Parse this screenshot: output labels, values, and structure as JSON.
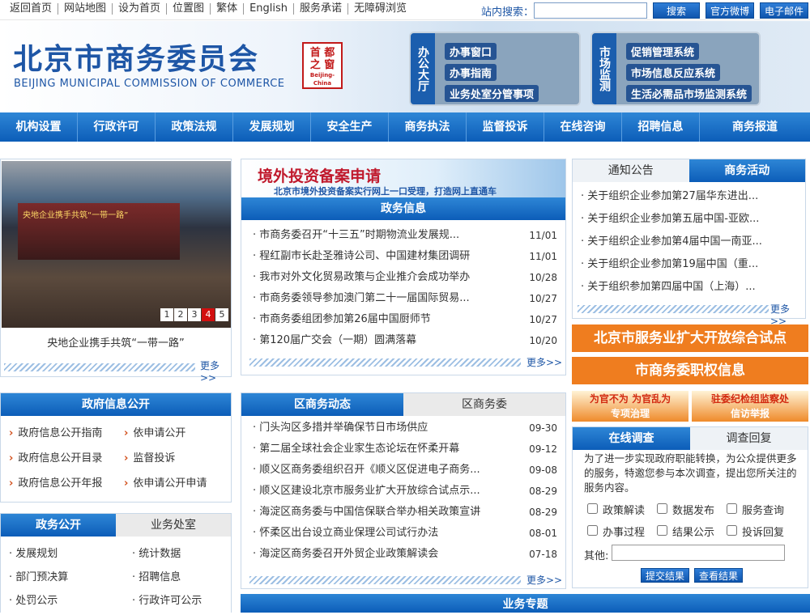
{
  "top": {
    "links": [
      "返回首页",
      "网站地图",
      "设为首页",
      "位置图",
      "繁体",
      "English",
      "服务承诺",
      "无障碍浏览"
    ],
    "search_label": "站内搜索：",
    "search_placeholder": "",
    "btn_search": "搜索",
    "btn_weibo": "官方微博",
    "btn_mail": "电子邮件"
  },
  "header": {
    "title_cn": "北京市商务委员会",
    "title_en": "BEIJING MUNICIPAL COMMISSION OF COMMERCE",
    "seal_top": "首 都",
    "seal_mid": "之 窗",
    "seal_sub": "Beijing-China",
    "panel1": {
      "tab": "办公大厅",
      "links": [
        "办事窗口",
        "办事指南",
        "业务处室分管事项"
      ]
    },
    "panel2": {
      "tab": "市场监测",
      "links": [
        "促销管理系统",
        "市场信息反应系统",
        "生活必需品市场监测系统"
      ]
    }
  },
  "nav": [
    "机构设置",
    "行政许可",
    "政策法规",
    "发展规划",
    "安全生产",
    "商务执法",
    "监督投诉",
    "在线咨询",
    "招聘信息",
    "商务报道"
  ],
  "slide": {
    "caption": "央地企业携手共筑“一带一路”",
    "pages": [
      "1",
      "2",
      "3",
      "4",
      "5"
    ],
    "active": "4",
    "more": "更多>>",
    "screen_text": "央地企业携手共筑“一带一路”"
  },
  "center_banner": {
    "title": "境外投资备案申请",
    "sub": "北京市境外投资备案实行网上一口受理，打造网上直通车"
  },
  "zwxx": {
    "title": "政务信息",
    "more": "更多>>",
    "items": [
      {
        "t": "市商务委召开“十三五”时期物流业发展规...",
        "d": "11/01"
      },
      {
        "t": "程红副市长赴圣雅诗公司、中国建材集团调研",
        "d": "11/01"
      },
      {
        "t": "我市对外文化贸易政策与企业推介会成功举办",
        "d": "10/28"
      },
      {
        "t": "市商务委领导参加澳门第二十一届国际贸易...",
        "d": "10/27"
      },
      {
        "t": "市商务委组团参加第26届中国厨师节",
        "d": "10/27"
      },
      {
        "t": "第120届广交会（一期）圆满落幕",
        "d": "10/20"
      }
    ]
  },
  "notice": {
    "tab1": "通知公告",
    "tab2": "商务活动",
    "more": "更多>>",
    "items": [
      "关于组织企业参加第27届华东进出...",
      "关于组织企业参加第五届中国-亚欧...",
      "关于组织企业参加第4届中国一南亚...",
      "关于组织企业参加第19届中国（重...",
      "关于组织参加第四届中国（上海）..."
    ]
  },
  "right_banners": {
    "b1": "北京市服务业扩大开放综合试点",
    "b2": "市商务委职权信息",
    "b3a": "为官不为 为官乱为",
    "b3b": "专项治理",
    "b4a": "驻委纪检组监察处",
    "b4b": "信访举报"
  },
  "gov": {
    "title": "政府信息公开",
    "items": [
      "政府信息公开指南",
      "依申请公开",
      "政府信息公开目录",
      "监督投诉",
      "政府信息公开年报",
      "依申请公开申请"
    ]
  },
  "district": {
    "tab1": "区商务动态",
    "tab2": "区商务委",
    "more": "更多>>",
    "items": [
      {
        "t": "门头沟区多措并举确保节日市场供应",
        "d": "09-30"
      },
      {
        "t": "第二届全球社会企业家生态论坛在怀柔开幕",
        "d": "09-12"
      },
      {
        "t": "顺义区商务委组织召开《顺义区促进电子商务...",
        "d": "09-08"
      },
      {
        "t": "顺义区建设北京市服务业扩大开放综合试点示...",
        "d": "08-29"
      },
      {
        "t": "海淀区商务委与中国信保联合举办相关政策宣讲",
        "d": "08-29"
      },
      {
        "t": "怀柔区出台设立商业保理公司试行办法",
        "d": "08-01"
      },
      {
        "t": "海淀区商务委召开外贸企业政策解读会",
        "d": "07-18"
      }
    ]
  },
  "survey": {
    "tab1": "在线调查",
    "tab2": "调查回复",
    "desc": "为了进一步实现政府职能转换，为公众提供更多的服务，特邀您参与本次调查，提出您所关注的服务内容。",
    "options": [
      "政策解读",
      "数据发布",
      "服务查询",
      "办事过程",
      "结果公示",
      "投诉回复"
    ],
    "other_label": "其他:",
    "submit": "提交结果",
    "view": "查看结果"
  },
  "zwgk": {
    "tab1": "政务公开",
    "tab2": "业务处室",
    "items": [
      "发展规划",
      "统计数据",
      "部门预决算",
      "招聘信息",
      "处罚公示",
      "行政许可公示"
    ]
  },
  "bottom": {
    "title": "业务专题"
  },
  "colors": {
    "blue": "#1e56a6",
    "orange": "#e8731c"
  }
}
